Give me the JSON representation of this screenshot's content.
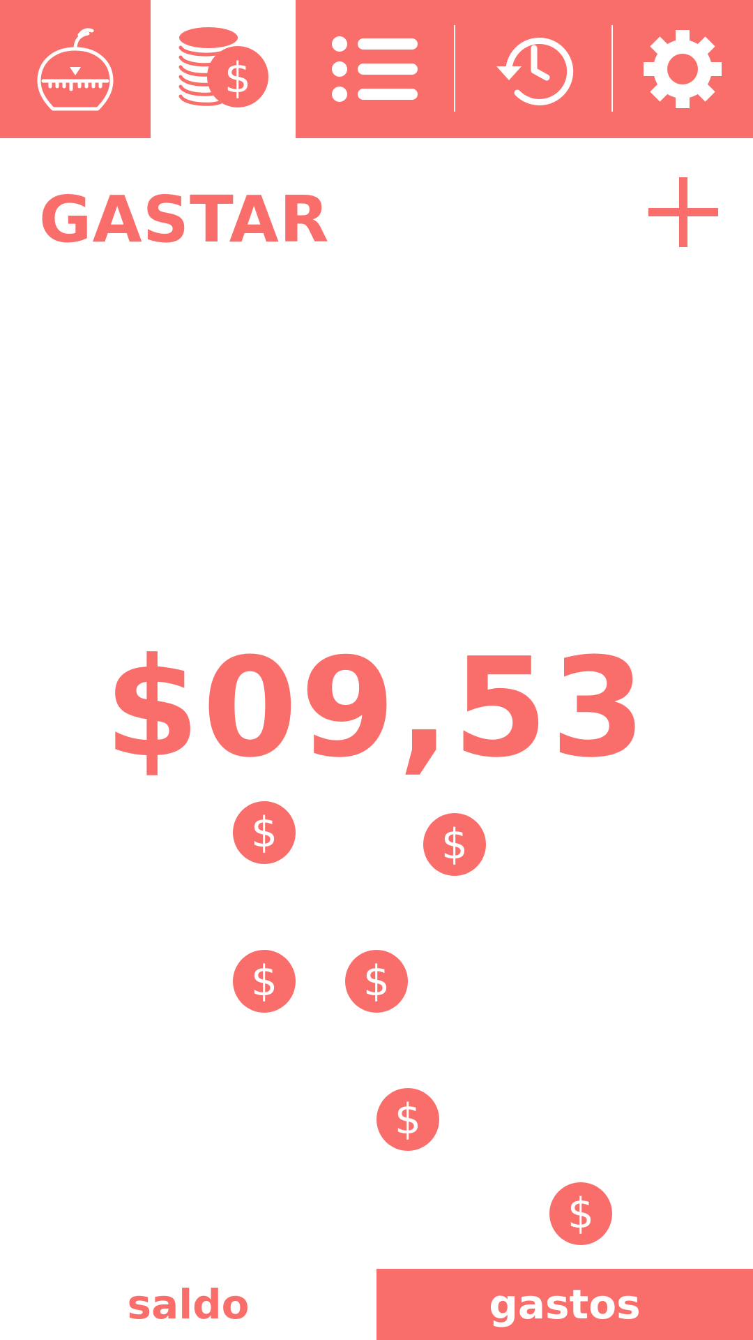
{
  "theme": {
    "accent": "#F96E6B",
    "background": "#FFFFFF"
  },
  "toolbar": {
    "items": [
      {
        "icon": "kitchen-timer-icon",
        "active": false
      },
      {
        "icon": "coins-dollar-icon",
        "active": true
      },
      {
        "icon": "list-icon",
        "active": false
      },
      {
        "icon": "history-clock-icon",
        "active": false
      },
      {
        "icon": "gear-icon",
        "active": false
      }
    ]
  },
  "header": {
    "title": "GASTAR",
    "add_icon": "plus-icon"
  },
  "amount": {
    "value": "$09,53"
  },
  "coins": {
    "symbol": "$",
    "count": 6
  },
  "tabs": {
    "saldo": "saldo",
    "gastos": "gastos",
    "selected": "gastos"
  }
}
